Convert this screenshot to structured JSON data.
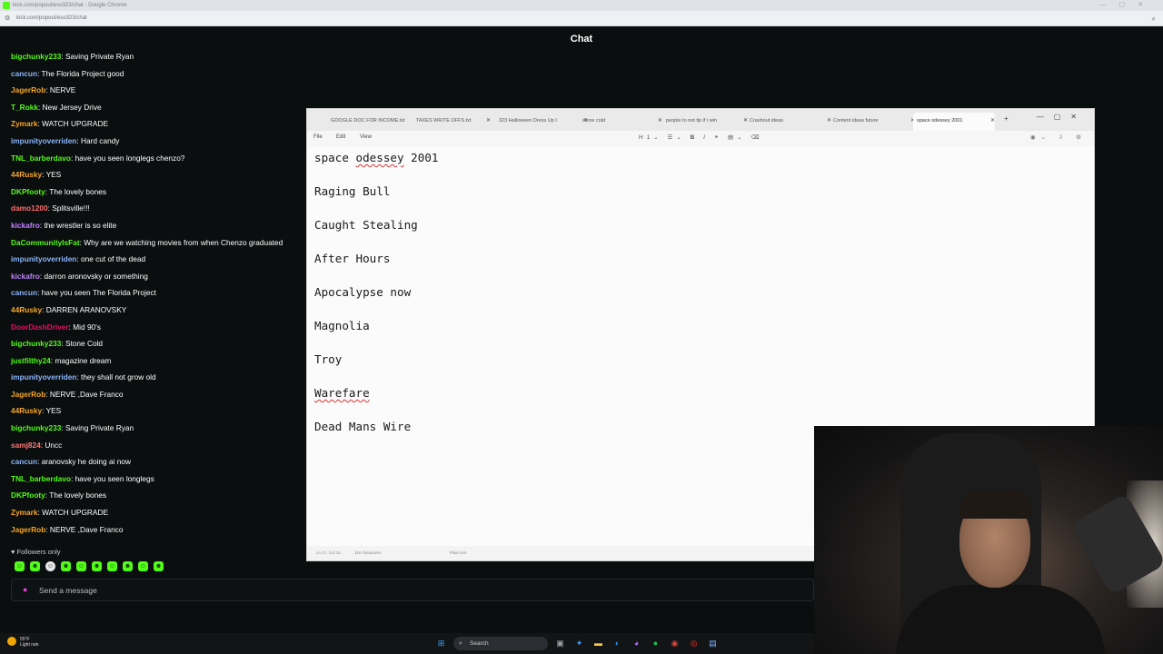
{
  "browser": {
    "window_title": "kick.com/popout/eso323/chat - Google Chrome",
    "url": "kick.com/popout/eso323/chat"
  },
  "chat": {
    "header_title": "Chat",
    "colors": {
      "kick_green": "#53fc18",
      "background": "#0b0e0f"
    },
    "messages": [
      {
        "user": "bigchunky233",
        "color": "#53fc18",
        "text": "Saving Private Ryan"
      },
      {
        "user": "cancun",
        "color": "#8ab4f8",
        "text": "The Florida Project good"
      },
      {
        "user": "JagerRob",
        "color": "#f5a623",
        "text": "NERVE"
      },
      {
        "user": "T_Rokk",
        "color": "#53fc18",
        "text": "New Jersey Drive"
      },
      {
        "user": "Zymark",
        "color": "#f5a623",
        "text": "WATCH UPGRADE"
      },
      {
        "user": "impunityoverriden",
        "color": "#8ab4f8",
        "text": "Hard candy"
      },
      {
        "user": "TNL_barberdavo",
        "color": "#53fc18",
        "text": "have you seen longlegs chenzo?"
      },
      {
        "user": "44Rusky",
        "color": "#f5a623",
        "text": "YES"
      },
      {
        "user": "DKPfooty",
        "color": "#53fc18",
        "text": "The lovely bones"
      },
      {
        "user": "damo1200",
        "color": "#ff6b6b",
        "text": "Splitsville!!!"
      },
      {
        "user": "kickafro",
        "color": "#c084fc",
        "text": "the wrestler is so elite"
      },
      {
        "user": "DaCommunityIsFat",
        "color": "#53fc18",
        "text": "Why are we watching movies from when Chenzo graduated"
      },
      {
        "user": "impunityoverriden",
        "color": "#8ab4f8",
        "text": "one cut of the dead"
      },
      {
        "user": "kickafro",
        "color": "#c084fc",
        "text": "darron aronovsky or something"
      },
      {
        "user": "cancun",
        "color": "#8ab4f8",
        "text": "have you seen The Florida Project"
      },
      {
        "user": "44Rusky",
        "color": "#f5a623",
        "text": "DARREN ARANOVSKY"
      },
      {
        "user": "DoorDashDriver",
        "color": "#e0115f",
        "text": "Mid 90's"
      },
      {
        "user": "bigchunky233",
        "color": "#53fc18",
        "text": "Stone Cold"
      },
      {
        "user": "justfilthy24",
        "color": "#53fc18",
        "text": "magazine dream"
      },
      {
        "user": "impunityoverriden",
        "color": "#8ab4f8",
        "text": "they shall not grow old"
      },
      {
        "user": "JagerRob",
        "color": "#f5a623",
        "text": "NERVE ,Dave Franco"
      },
      {
        "user": "44Rusky",
        "color": "#f5a623",
        "text": "YES"
      },
      {
        "user": "bigchunky233",
        "color": "#53fc18",
        "text": "Saving Private Ryan"
      },
      {
        "user": "samj824",
        "color": "#ff7a7a",
        "text": "Uncc"
      },
      {
        "user": "cancun",
        "color": "#8ab4f8",
        "text": "aranovsky he doing ai now"
      },
      {
        "user": "TNL_barberdavo",
        "color": "#53fc18",
        "text": "have you seen longlegs"
      },
      {
        "user": "DKPfooty",
        "color": "#53fc18",
        "text": "The lovely bones"
      },
      {
        "user": "Zymark",
        "color": "#f5a623",
        "text": "WATCH UPGRADE"
      },
      {
        "user": "JagerRob",
        "color": "#f5a623",
        "text": "NERVE ,Dave Franco"
      }
    ],
    "followers_only_label": "Followers only",
    "send_placeholder": "Send a message"
  },
  "notepad": {
    "tabs": [
      {
        "label": "GOOGLE DOC FOR INCOME.txt",
        "active": false
      },
      {
        "label": "TAXES WRITE OFFS.txt",
        "active": false
      },
      {
        "label": "323 Halloween Dress Up I",
        "active": false
      },
      {
        "label": "stone cold",
        "active": false
      },
      {
        "label": "people to not tip if i win",
        "active": false
      },
      {
        "label": "Crashout ideas",
        "active": false
      },
      {
        "label": "Content ideas future",
        "active": false
      },
      {
        "label": "space odessey 2001",
        "active": true
      }
    ],
    "menu": {
      "file": "File",
      "edit": "Edit",
      "view": "View"
    },
    "lines": [
      {
        "text": "space odessey 2001",
        "misspelled": "odessey"
      },
      {
        "text": "Raging Bull",
        "misspelled": ""
      },
      {
        "text": "Caught Stealing",
        "misspelled": ""
      },
      {
        "text": "After Hours",
        "misspelled": ""
      },
      {
        "text": "Apocalypse now",
        "misspelled": ""
      },
      {
        "text": "Magnolia",
        "misspelled": ""
      },
      {
        "text": "Troy",
        "misspelled": ""
      },
      {
        "text": "Warefare",
        "misspelled": "Warefare"
      },
      {
        "text": "Dead Mans Wire",
        "misspelled": ""
      }
    ],
    "status": {
      "position": "Ln 17, Col 15",
      "characters": "118 characters",
      "format": "Plain text"
    }
  },
  "taskbar": {
    "weather": "55°F",
    "weather_desc": "Light rain",
    "search_label": "Search"
  }
}
